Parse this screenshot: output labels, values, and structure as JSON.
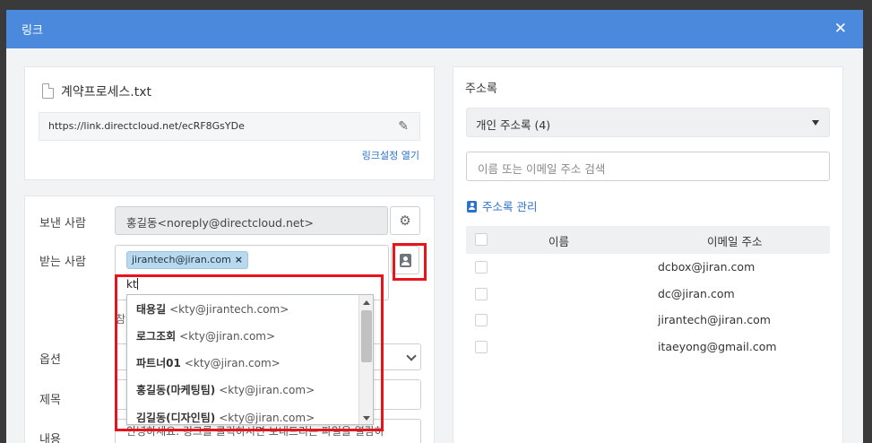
{
  "dialog": {
    "title": "링크",
    "close_icon": "close-icon"
  },
  "file": {
    "name": "계약프로세스.txt",
    "url": "https://link.directcloud.net/ecRF8GsYDe",
    "link_settings_label": "링크설정 열기"
  },
  "form": {
    "sender_label": "보낸 사람",
    "sender_value": "홍길동<noreply@directcloud.net>",
    "recipient_label": "받는 사람",
    "recipient_tag": "jirantech@jiran.com",
    "recipient_tag_remove": "×",
    "recipient_typed": "kt",
    "hint_fragment": "참",
    "options_label": "옵션",
    "subject_label": "제목",
    "content_label": "내용",
    "content_value": "안녕하세요. 링크를 클릭하시면 보내드리는 파일을 열람하"
  },
  "autocomplete": [
    {
      "name": "태용길",
      "email": "<kty@jirantech.com>"
    },
    {
      "name": "로그조회",
      "email": "<kty@jiran.com>"
    },
    {
      "name": "파트너01",
      "email": "<kty@jiran.com>"
    },
    {
      "name": "홍길동(마케팅팀)",
      "email": "<kty@jiran.com>"
    },
    {
      "name": "김길동(디자인팀)",
      "email": "<kty@jiran.com>"
    }
  ],
  "address_book": {
    "title": "주소록",
    "selected_book": "개인 주소록 (4)",
    "search_placeholder": "이름 또는 이메일 주소 검색",
    "manage_label": "주소록 관리",
    "columns": {
      "name": "이름",
      "email": "이메일 주소"
    },
    "rows": [
      {
        "name": "",
        "email": "dcbox@jiran.com"
      },
      {
        "name": "",
        "email": "dc@jiran.com"
      },
      {
        "name": "",
        "email": "jirantech@jiran.com"
      },
      {
        "name": "",
        "email": "itaeyong@gmail.com"
      }
    ]
  },
  "colors": {
    "header": "#4a89dc",
    "link": "#2d72c9",
    "highlight": "#e8141b",
    "tag": "#b8d8ee"
  }
}
